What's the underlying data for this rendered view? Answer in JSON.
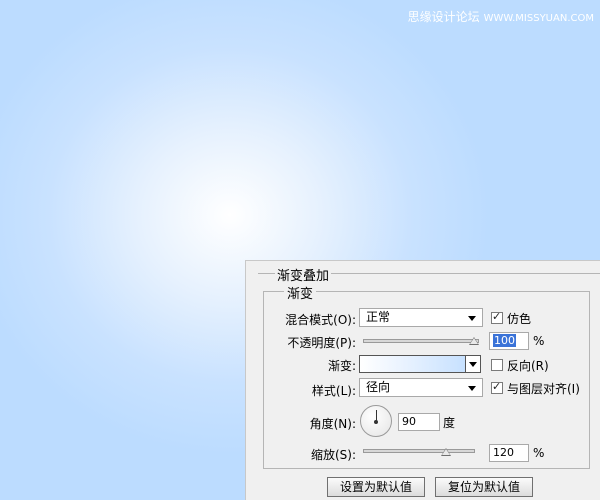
{
  "watermark": {
    "text": "思缘设计论坛",
    "site": "WWW.MISSYUAN.COM"
  },
  "dialog": {
    "title": "渐变叠加",
    "section_title": "渐变",
    "blend_mode": {
      "label": "混合模式(O):",
      "value": "正常"
    },
    "dither": {
      "label": "仿色",
      "checked": true
    },
    "opacity": {
      "label": "不透明度(P):",
      "value": "100",
      "unit": "%",
      "level": 100
    },
    "gradient": {
      "label": "渐变:",
      "colors": [
        "#ffffff",
        "#c7e1ff"
      ]
    },
    "reverse": {
      "label": "反向(R)",
      "checked": false
    },
    "style": {
      "label": "样式(L):",
      "value": "径向"
    },
    "align_with_layer": {
      "label": "与图层对齐(I)",
      "checked": true
    },
    "angle": {
      "label": "角度(N):",
      "value": "90",
      "unit": "度"
    },
    "scale": {
      "label": "缩放(S):",
      "value": "120",
      "unit": "%",
      "level": 120
    },
    "buttons": {
      "make_default": "设置为默认值",
      "reset_default": "复位为默认值"
    }
  }
}
